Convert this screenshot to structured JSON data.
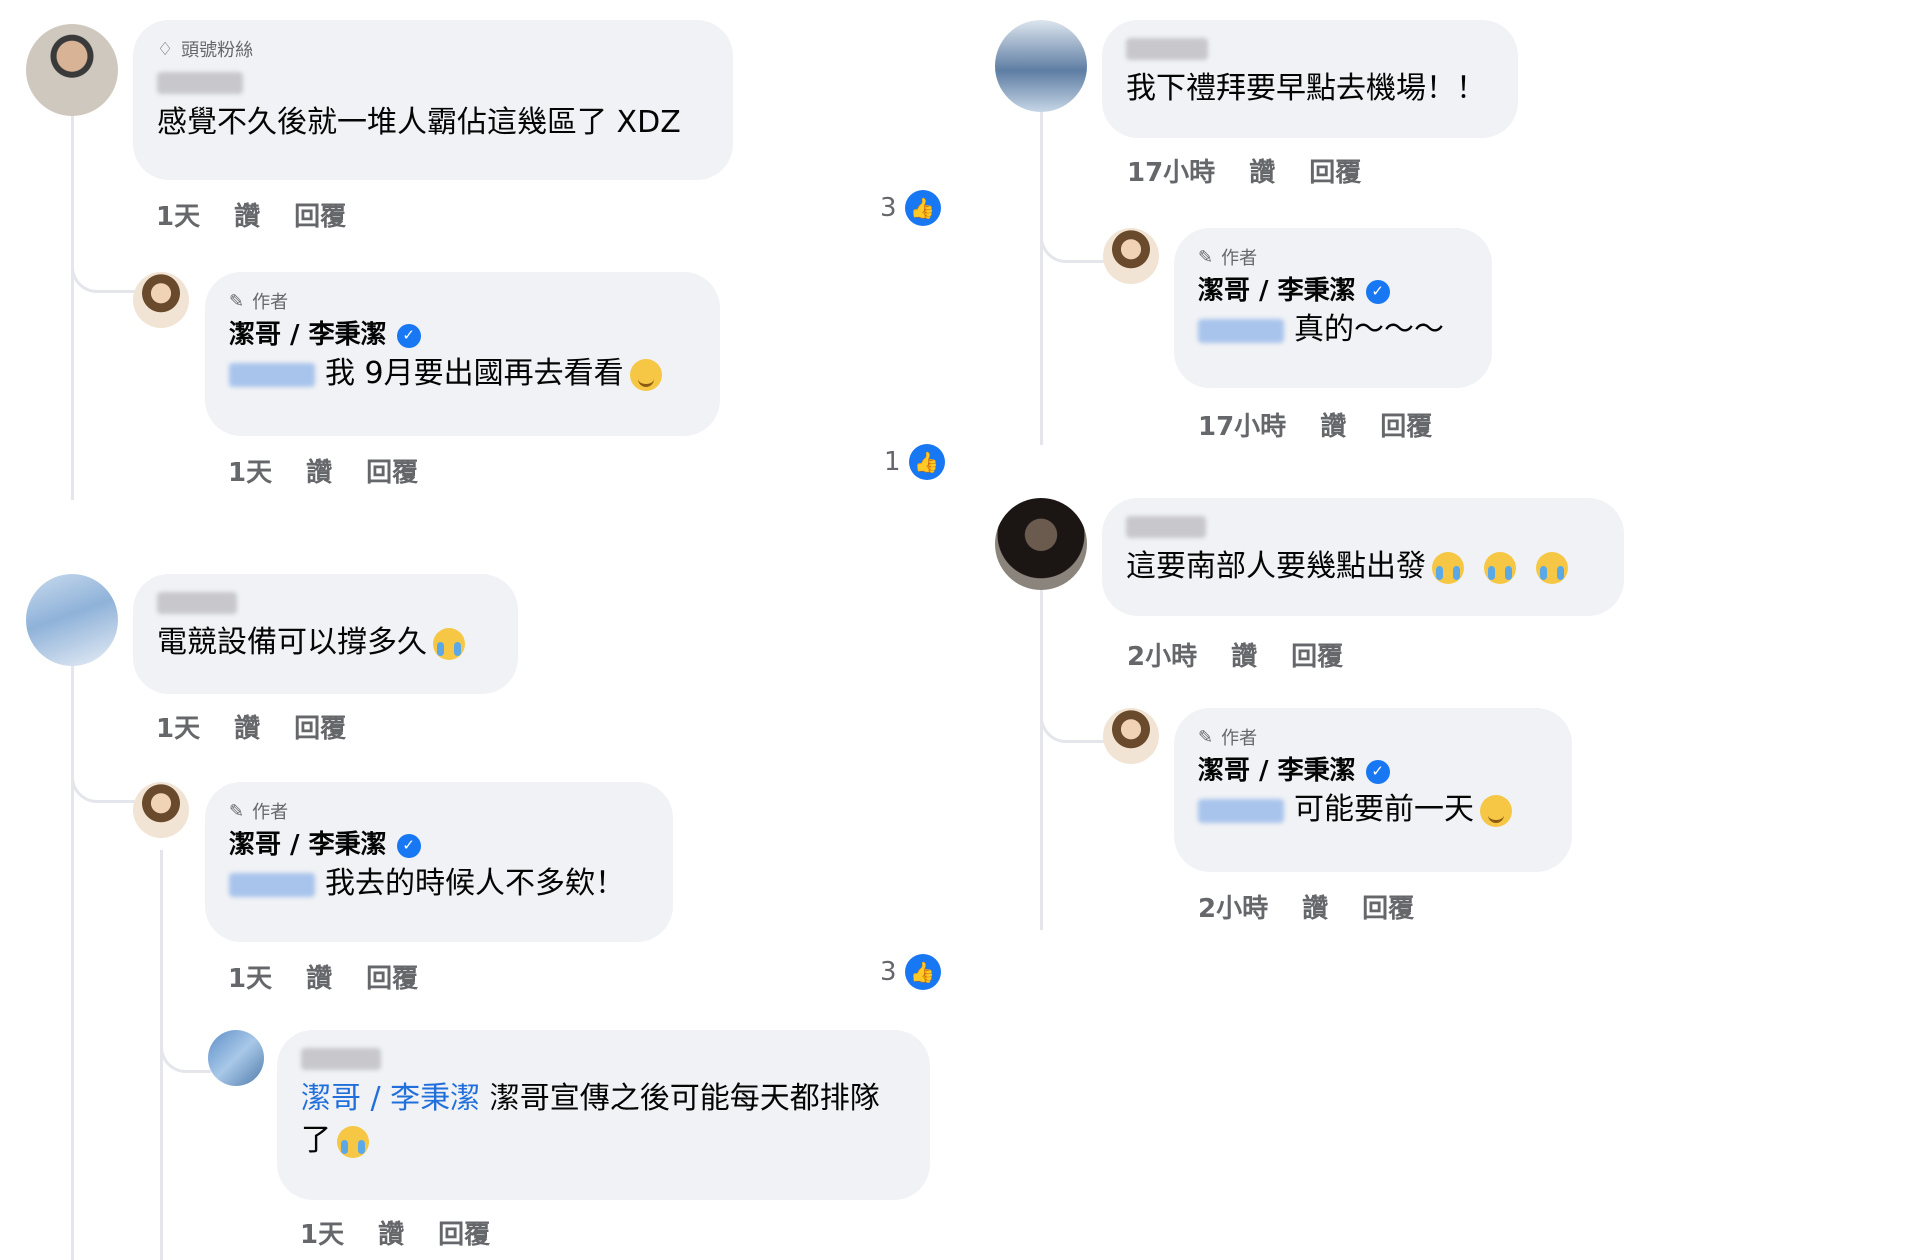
{
  "labels": {
    "like": "讚",
    "reply": "回覆",
    "author_badge": "作者",
    "top_fan_badge": "頭號粉絲",
    "verified_mark": "✓",
    "like_glyph": "👍",
    "pen_glyph": "✎",
    "gem_glyph": "♢"
  },
  "left": {
    "thread1": {
      "comment_text": "感覺不久後就一堆人霸佔這幾區了 XDZ",
      "time": "1天",
      "likes": "3",
      "reply": {
        "author": "潔哥 / 李秉潔",
        "text": "我 9月要出國再去看看",
        "time": "1天",
        "likes": "1"
      }
    },
    "thread2": {
      "comment_text": "電競設備可以撐多久",
      "time": "1天",
      "reply": {
        "author": "潔哥 / 李秉潔",
        "text": "我去的時候人不多欸！",
        "time": "1天",
        "likes": "3"
      },
      "reply2": {
        "mention": "潔哥 / 李秉潔",
        "text": "潔哥宣傳之後可能每天都排隊了",
        "time": "1天"
      }
    }
  },
  "right": {
    "thread1": {
      "comment_text": "我下禮拜要早點去機場！！",
      "time": "17小時",
      "reply": {
        "author": "潔哥 / 李秉潔",
        "text": "真的～～～",
        "time": "17小時"
      }
    },
    "thread2": {
      "comment_text": "這要南部人要幾點出發",
      "time": "2小時",
      "reply": {
        "author": "潔哥 / 李秉潔",
        "text": "可能要前一天",
        "time": "2小時"
      }
    }
  },
  "colors": {
    "bubble": "#f0f2f5",
    "meta": "#65676b",
    "mention": "#216fdb",
    "brand": "#1877f2"
  }
}
